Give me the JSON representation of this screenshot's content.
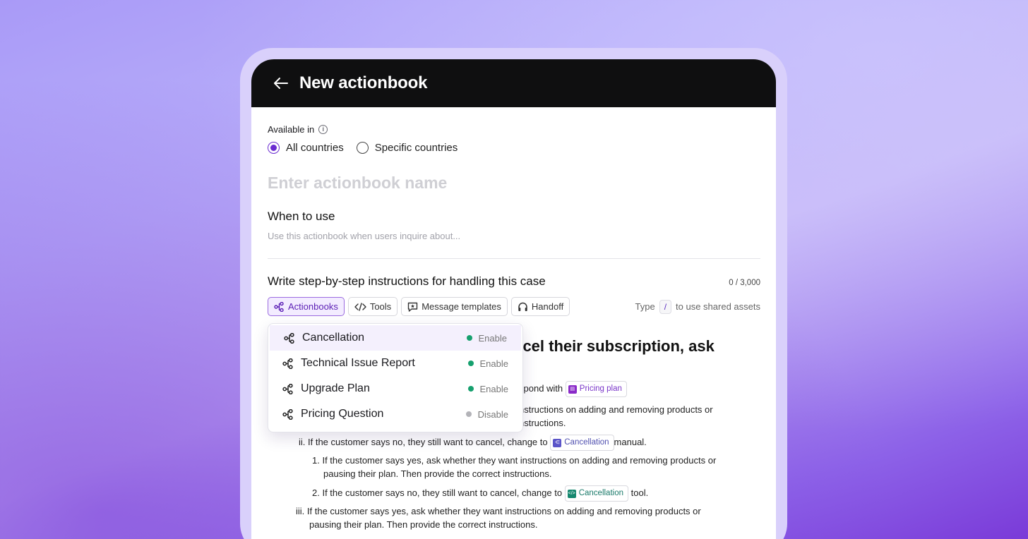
{
  "header": {
    "title": "New actionbook"
  },
  "availability": {
    "label": "Available in",
    "options": [
      {
        "label": "All countries",
        "selected": true
      },
      {
        "label": "Specific countries",
        "selected": false
      }
    ]
  },
  "name_field": {
    "placeholder": "Enter actionbook name"
  },
  "when_to_use": {
    "heading": "When to use",
    "placeholder": "Use this actionbook when users inquire about..."
  },
  "instructions": {
    "heading": "Write step-by-step instructions for handling this case",
    "count": "0 / 3,000"
  },
  "toolbar": {
    "actionbooks": "Actionbooks",
    "tools": "Tools",
    "message_templates": "Message templates",
    "handoff": "Handoff",
    "hint_prefix": "Type",
    "hint_key": "/",
    "hint_suffix": "to use shared assets"
  },
  "dropdown": {
    "items": [
      {
        "label": "Cancellation",
        "status": "Enable",
        "color": "#16a06e"
      },
      {
        "label": "Technical Issue Report",
        "status": "Enable",
        "color": "#16a06e"
      },
      {
        "label": "Upgrade Plan",
        "status": "Enable",
        "color": "#16a06e"
      },
      {
        "label": "Pricing Question",
        "status": "Disable",
        "color": "#b3b3b8"
      }
    ]
  },
  "editor": {
    "big_text": "ncel their subscription, ask",
    "line1_text": "spond with",
    "chip_pricing": "Pricing plan",
    "line2a": "nstructions on adding and removing products or",
    "line2b": "nstructions.",
    "line3_prefix": "ii. If the customer says no, they still want to cancel, change to",
    "chip_cancel1": "Cancellation",
    "line3_suffix": "manual.",
    "line4a": "1. If the customer says yes, ask whether they want instructions on adding and removing products or",
    "line4b": "pausing their plan. Then provide the correct instructions.",
    "line5_prefix": "2. If the customer says no, they still want to cancel, change to",
    "chip_cancel2": "Cancellation",
    "line5_suffix": "tool.",
    "line6a": "iii. If the customer says yes, ask whether they want instructions on adding and removing products or",
    "line6b": "pausing their plan. Then provide the correct instructions."
  }
}
